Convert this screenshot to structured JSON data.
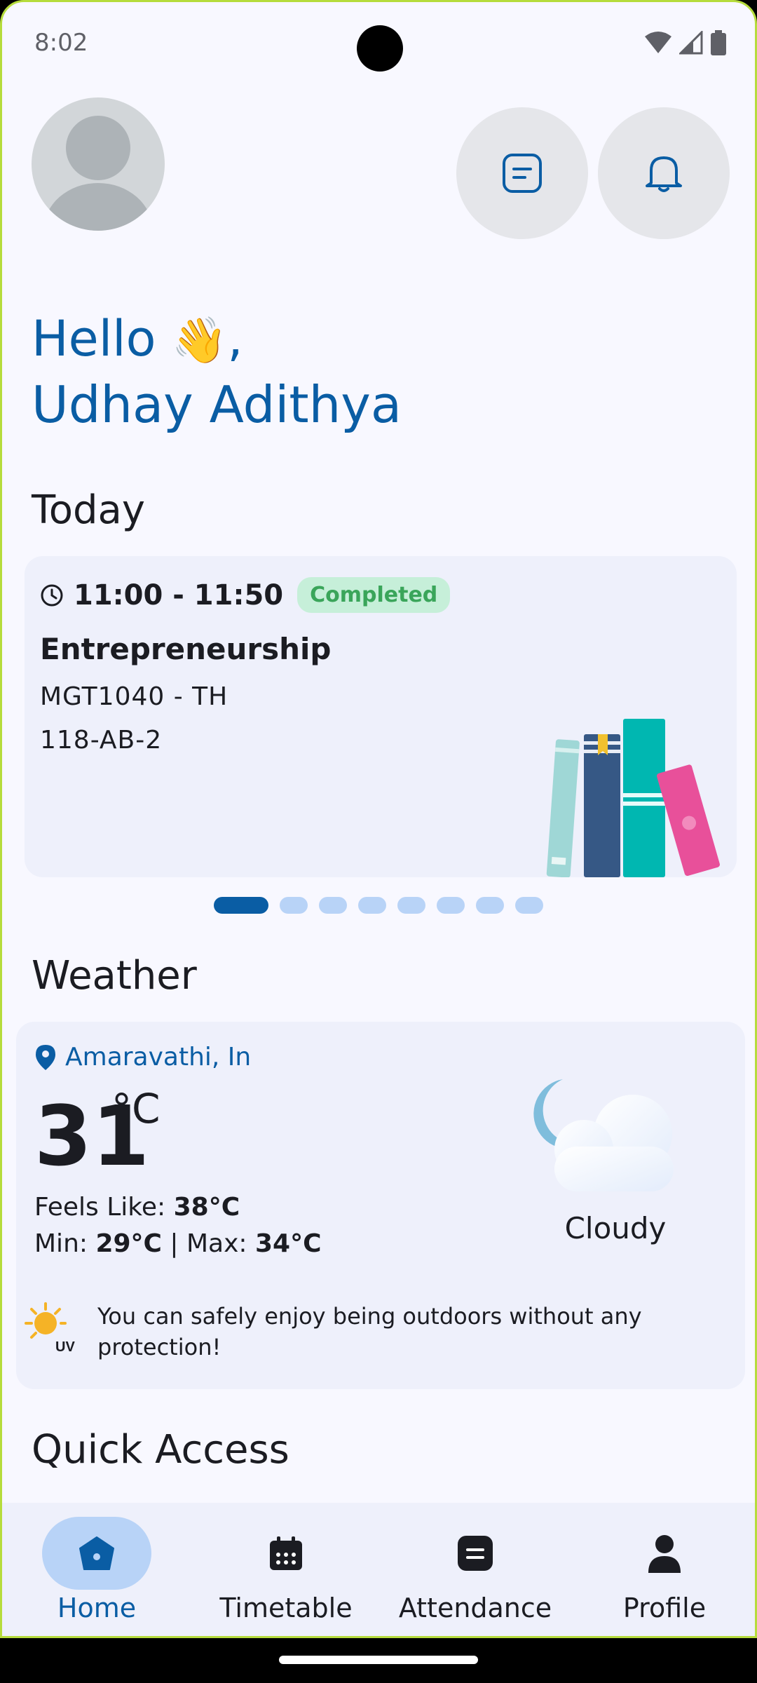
{
  "status_bar": {
    "time": "8:02"
  },
  "greeting": {
    "hello": "Hello",
    "wave": "👋",
    "comma": ",",
    "name": "Udhay Adithya"
  },
  "sections": {
    "today": "Today",
    "weather": "Weather",
    "quick_access": "Quick Access"
  },
  "class_card": {
    "time": "11:00 - 11:50",
    "status": "Completed",
    "course_name": "Entrepreneurship",
    "course_code": "MGT1040 - TH",
    "room": "118-AB-2",
    "pager": {
      "total": 8,
      "active": 0
    }
  },
  "weather": {
    "location": "Amaravathi, In",
    "temperature": "31",
    "unit": "°C",
    "feels_label": "Feels Like: ",
    "feels_value": "38°C",
    "min_label": "Min: ",
    "min_value": "29°C",
    "separator": " | Max: ",
    "max_value": "34°C",
    "condition": "Cloudy",
    "uv_message": "You can safely enjoy being outdoors without any protection!"
  },
  "nav": [
    {
      "label": "Home",
      "icon": "home-icon",
      "active": true
    },
    {
      "label": "Timetable",
      "icon": "calendar-icon",
      "active": false
    },
    {
      "label": "Attendance",
      "icon": "attendance-icon",
      "active": false
    },
    {
      "label": "Profile",
      "icon": "person-icon",
      "active": false
    }
  ],
  "colors": {
    "primary": "#0a5da4",
    "background": "#f8f8ff",
    "card": "#eef0fb",
    "badge_bg": "#c6efd9",
    "badge_text": "#3aa55a"
  }
}
